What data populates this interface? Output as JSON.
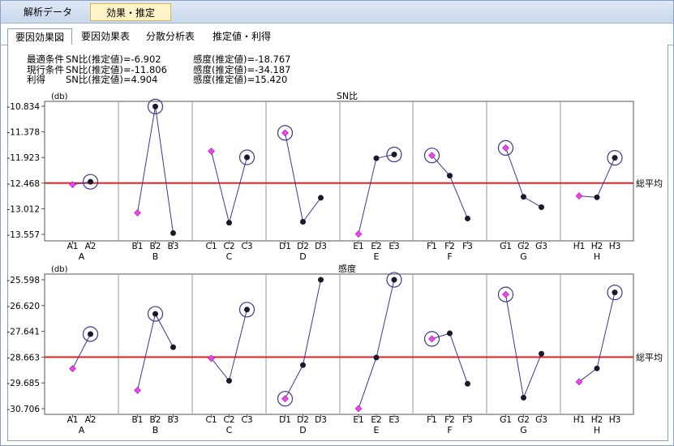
{
  "top_tabs": [
    {
      "label": "解析データ"
    },
    {
      "label": "効果・推定",
      "active": true
    }
  ],
  "sub_tabs": [
    {
      "label": "要因効果図",
      "active": true
    },
    {
      "label": "要因効果表"
    },
    {
      "label": "分散分析表"
    },
    {
      "label": "推定値・利得"
    }
  ],
  "conditions": [
    {
      "label": "最適条件",
      "sn": "SN比(推定値)=-6.902",
      "sens": "感度(推定値)=-18.767"
    },
    {
      "label": "現行条件",
      "sn": "SN比(推定値)=-11.806",
      "sens": "感度(推定値)=-34.187"
    },
    {
      "label": "利得",
      "sn": "SN比(推定値)=4.904",
      "sens": "感度(推定値)=15.420"
    }
  ],
  "colors": {
    "line": "#3a3a8c",
    "average_line": "#ee2222",
    "diamond": "#ee44ee",
    "dot": "#1a1a2e",
    "grid": "#999999"
  },
  "chart_data": [
    {
      "type": "line",
      "title": "SN比",
      "ylabel": "(db)",
      "ylim": [
        -13.557,
        -10.834
      ],
      "yticks": [
        "-10.834",
        "-11.378",
        "-11.923",
        "-12.468",
        "-13.012",
        "-13.557"
      ],
      "average": -12.468,
      "average_label": "総平均",
      "factors": [
        {
          "name": "A",
          "levels": [
            "A1",
            "A2"
          ],
          "values": [
            -12.5,
            -12.44
          ],
          "current": 0,
          "optimal": 1
        },
        {
          "name": "B",
          "levels": [
            "B1",
            "B2",
            "B3"
          ],
          "values": [
            -13.1,
            -10.84,
            -13.53
          ],
          "current": 0,
          "optimal": 1
        },
        {
          "name": "C",
          "levels": [
            "C1",
            "C2",
            "C3"
          ],
          "values": [
            -11.79,
            -13.31,
            -11.92
          ],
          "current": 0,
          "optimal": 2
        },
        {
          "name": "D",
          "levels": [
            "D1",
            "D2",
            "D3"
          ],
          "values": [
            -11.4,
            -13.29,
            -12.78
          ],
          "current": 0,
          "optimal": 0
        },
        {
          "name": "E",
          "levels": [
            "E1",
            "E2",
            "E3"
          ],
          "values": [
            -13.55,
            -11.94,
            -11.86
          ],
          "current": 0,
          "optimal": 2
        },
        {
          "name": "F",
          "levels": [
            "F1",
            "F2",
            "F3"
          ],
          "values": [
            -11.88,
            -12.31,
            -13.22
          ],
          "current": 0,
          "optimal": 0
        },
        {
          "name": "G",
          "levels": [
            "G1",
            "G2",
            "G3"
          ],
          "values": [
            -11.72,
            -12.76,
            -12.98
          ],
          "current": 0,
          "optimal": 0
        },
        {
          "name": "H",
          "levels": [
            "H1",
            "H2",
            "H3"
          ],
          "values": [
            -12.74,
            -12.77,
            -11.93
          ],
          "current": 0,
          "optimal": 2
        }
      ]
    },
    {
      "type": "line",
      "title": "感度",
      "ylabel": "(db)",
      "ylim": [
        -30.706,
        -25.598
      ],
      "yticks": [
        "-25.598",
        "-26.620",
        "-27.641",
        "-28.663",
        "-29.685",
        "-30.706"
      ],
      "average": -28.663,
      "average_label": "総平均",
      "factors": [
        {
          "name": "A",
          "levels": [
            "A1",
            "A2"
          ],
          "values": [
            -29.12,
            -27.75
          ],
          "current": 0,
          "optimal": 1
        },
        {
          "name": "B",
          "levels": [
            "B1",
            "B2",
            "B3"
          ],
          "values": [
            -29.98,
            -26.95,
            -28.27
          ],
          "current": 0,
          "optimal": 1
        },
        {
          "name": "C",
          "levels": [
            "C1",
            "C2",
            "C3"
          ],
          "values": [
            -28.71,
            -29.6,
            -26.78
          ],
          "current": 0,
          "optimal": 2
        },
        {
          "name": "D",
          "levels": [
            "D1",
            "D2",
            "D3"
          ],
          "values": [
            -30.31,
            -28.98,
            -25.6
          ],
          "current": 0,
          "optimal": 0
        },
        {
          "name": "E",
          "levels": [
            "E1",
            "E2",
            "E3"
          ],
          "values": [
            -30.7,
            -28.68,
            -25.6
          ],
          "current": 0,
          "optimal": 2
        },
        {
          "name": "F",
          "levels": [
            "F1",
            "F2",
            "F3"
          ],
          "values": [
            -27.94,
            -27.72,
            -29.72
          ],
          "current": 0,
          "optimal": 0
        },
        {
          "name": "G",
          "levels": [
            "G1",
            "G2",
            "G3"
          ],
          "values": [
            -26.18,
            -30.27,
            -28.53
          ],
          "current": 0,
          "optimal": 0
        },
        {
          "name": "H",
          "levels": [
            "H1",
            "H2",
            "H3"
          ],
          "values": [
            -29.64,
            -29.11,
            -26.1
          ],
          "current": 0,
          "optimal": 2
        }
      ]
    }
  ]
}
